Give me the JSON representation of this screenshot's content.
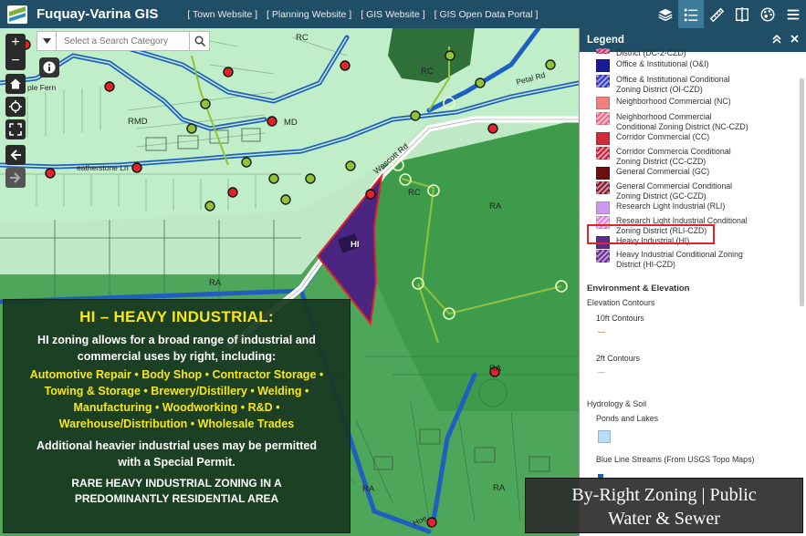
{
  "header": {
    "app_title": "Fuquay-Varina GIS",
    "links": [
      "[ Town Website ]",
      "[ Planning Website ]",
      "[ GIS Website ]",
      "[ GIS Open Data Portal ]"
    ]
  },
  "search": {
    "placeholder": "Select a Search Category"
  },
  "map_controls": {
    "zoom_in": "+",
    "zoom_out": "−"
  },
  "map_labels": {
    "rc_1": "RC",
    "rc_2": "RC",
    "rc_3": "RC",
    "rmd": "RMD",
    "md": "MD",
    "ra_1": "RA",
    "ra_2": "RA",
    "ra_3": "RA",
    "ra_4": "RA",
    "ra_5": "RA",
    "ra_6": "RA",
    "hi": "HI",
    "street_wescott": "Wescott Rd",
    "street_featherstone": "eatherstone Ln",
    "street_maple": "ple Fern",
    "street_petal": "Petal Rd",
    "street_bottom": "Hoe"
  },
  "callout": {
    "title": "HI – HEAVY INDUSTRIAL:",
    "intro": "HI zoning allows for a broad range of industrial and commercial uses by right, including:",
    "uses": "Automotive Repair • Body Shop • Contractor Storage • Towing & Storage • Brewery/Distillery • Welding • Manufacturing • Woodworking • R&D • Warehouse/Distribution • Wholesale Trades",
    "extra": "Additional heavier industrial uses may be permitted with a Special Permit.",
    "rare": "RARE HEAVY INDUSTRIAL ZONING IN A PREDOMINANTLY RESIDENTIAL AREA"
  },
  "legend": {
    "title": "Legend",
    "items": [
      {
        "label": "District (DC-2-CZD)",
        "color": "#cc3366",
        "hatch": true
      },
      {
        "label": "Office & Institutional (O&I)",
        "color": "#1a1a99",
        "hatch": false
      },
      {
        "label": "Office & Institutional Conditional Zoning District (OI-CZD)",
        "color": "#3333cc",
        "hatch": true
      },
      {
        "label": "Neighborhood Commercial (NC)",
        "color": "#f08080",
        "hatch": false
      },
      {
        "label": "Neighborhood Commercial Conditional Zoning District (NC-CZD)",
        "color": "#f06a8a",
        "hatch": true
      },
      {
        "label": "Corridor Commercial (CC)",
        "color": "#d12a3a",
        "hatch": false
      },
      {
        "label": "Corridor Commercia Conditional Zoning District (CC-CZD)",
        "color": "#c8203a",
        "hatch": true
      },
      {
        "label": "General Commercial (GC)",
        "color": "#6e0e0e",
        "hatch": false
      },
      {
        "label": "General Commercial Conditional Zoning District (GC-CZD)",
        "color": "#8a1530",
        "hatch": true
      },
      {
        "label": "Research Light Industrial (RLI)",
        "color": "#cc99ee",
        "hatch": false
      },
      {
        "label": "Research Light Industrial Conditional Zoning District (RLI-CZD)",
        "color": "#dd88dd",
        "hatch": true
      },
      {
        "label": "Heavy Industrial (HI)",
        "color": "#5b2d8a",
        "hatch": false
      },
      {
        "label": "Heavy Industrial Conditional Zoning District (HI-CZD)",
        "color": "#6a2a9a",
        "hatch": true
      }
    ],
    "env_title": "Environment & Elevation",
    "contours_title": "Elevation Contours",
    "ten_ft": "10ft Contours",
    "two_ft": "2ft Contours",
    "hydro_title": "Hydrology & Soil",
    "ponds": "Ponds and Lakes",
    "streams": "Blue Line Streams (From USGS Topo Maps)"
  },
  "banner": {
    "line1": "By-Right Zoning | Public",
    "line2": "Water & Sewer"
  },
  "colors": {
    "header": "#1f4e66",
    "hi_zone": "#4b2680",
    "callout_bg": "#183820",
    "callout_accent": "#f7e61a",
    "highlight": "#e0242a"
  }
}
